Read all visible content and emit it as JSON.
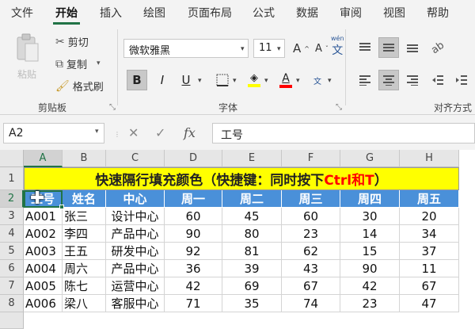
{
  "menu": {
    "items": [
      "文件",
      "开始",
      "插入",
      "绘图",
      "页面布局",
      "公式",
      "数据",
      "审阅",
      "视图",
      "帮助"
    ],
    "active": "开始"
  },
  "ribbon": {
    "clipboard": {
      "paste_label": "粘贴",
      "cut_label": "剪切",
      "copy_label": "复制",
      "format_painter_label": "格式刷",
      "group_label": "剪贴板"
    },
    "font": {
      "font_name": "微软雅黑",
      "font_size": "11",
      "grow_label": "A",
      "shrink_label": "A",
      "wen_label": "wén",
      "wen_char": "文",
      "bold": "B",
      "italic": "I",
      "underline": "U",
      "font_color_glyph": "A",
      "group_label": "字体"
    },
    "alignment": {
      "group_label": "对齐方式"
    }
  },
  "formula_bar": {
    "name_box": "A2",
    "cancel": "✕",
    "enter": "✓",
    "fx": "fx",
    "content": "工号"
  },
  "sheet": {
    "columns": [
      "A",
      "B",
      "C",
      "D",
      "E",
      "F",
      "G",
      "H"
    ],
    "selected_column": "A",
    "selected_row": "2",
    "rows": [
      "1",
      "2",
      "3",
      "4",
      "5",
      "6",
      "7",
      "8"
    ],
    "title": {
      "main": "快速隔行填充颜色（快捷键：同时按下",
      "highlight": "Ctrl和T",
      "end": "）"
    },
    "header_row": [
      "工号",
      "姓名",
      "中心",
      "周一",
      "周二",
      "周三",
      "周四",
      "周五"
    ],
    "data_rows": [
      [
        "A001",
        "张三",
        "设计中心",
        "60",
        "45",
        "60",
        "30",
        "20"
      ],
      [
        "A002",
        "李四",
        "产品中心",
        "90",
        "80",
        "23",
        "14",
        "34"
      ],
      [
        "A003",
        "王五",
        "研发中心",
        "92",
        "81",
        "62",
        "15",
        "37"
      ],
      [
        "A004",
        "周六",
        "产品中心",
        "36",
        "39",
        "43",
        "90",
        "11"
      ],
      [
        "A005",
        "陈七",
        "运营中心",
        "42",
        "69",
        "67",
        "42",
        "67"
      ],
      [
        "A006",
        "梁八",
        "客服中心",
        "71",
        "35",
        "74",
        "23",
        "47"
      ]
    ]
  },
  "colors": {
    "accent": "#217346",
    "title_fill": "#ffff00",
    "header_fill": "#4a90d9",
    "title_highlight": "#ff0000"
  },
  "icons": [
    "paste-icon",
    "scissors-icon",
    "copy-icon",
    "format-painter-icon",
    "increase-font-icon",
    "decrease-font-icon",
    "phonetic-icon",
    "border-icon",
    "fill-color-icon",
    "font-color-icon",
    "align-top-icon",
    "align-middle-icon",
    "align-bottom-icon",
    "cross-cursor-icon"
  ]
}
